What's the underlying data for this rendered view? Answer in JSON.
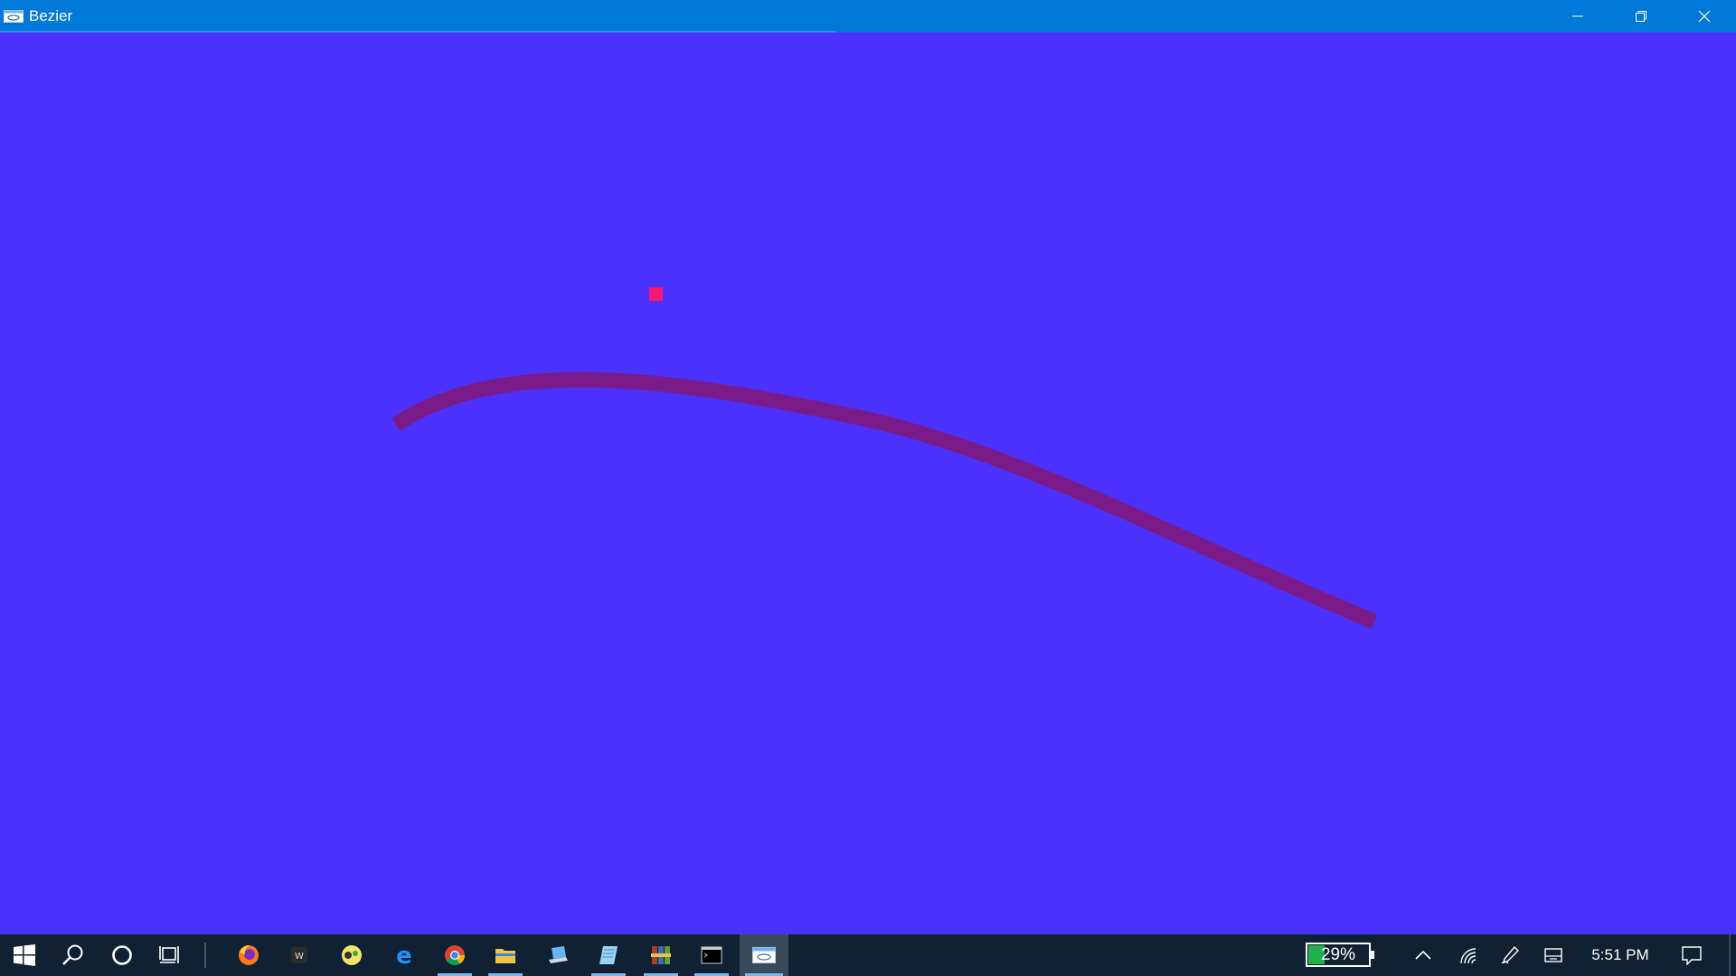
{
  "window": {
    "title": "Bezier",
    "icons": {
      "app": "app-window-icon",
      "minimize": "minimize-icon",
      "maximize": "restore-icon",
      "close": "close-icon"
    }
  },
  "canvas": {
    "background": "#4b31fe",
    "curve_color": "#7b1b8a",
    "control_point_color": "#ff1673"
  },
  "taskbar": {
    "icons": [
      "windows-start-icon",
      "search-icon",
      "cortana-icon",
      "task-view-icon",
      "firefox-icon",
      "app-icon",
      "snipping-icon",
      "edge-icon",
      "chrome-icon",
      "file-explorer-icon",
      "laptop-icon",
      "notepad-icon",
      "winrar-icon",
      "terminal-icon",
      "bezier-app-icon"
    ],
    "battery": {
      "label": "29%",
      "level": 0.29,
      "color": "#21b14a"
    },
    "tray_icons": [
      "show-hidden-icons-icon",
      "wifi-icon",
      "pen-icon",
      "keyboard-icon",
      "notification-icon"
    ],
    "clock": "5:51 PM"
  }
}
